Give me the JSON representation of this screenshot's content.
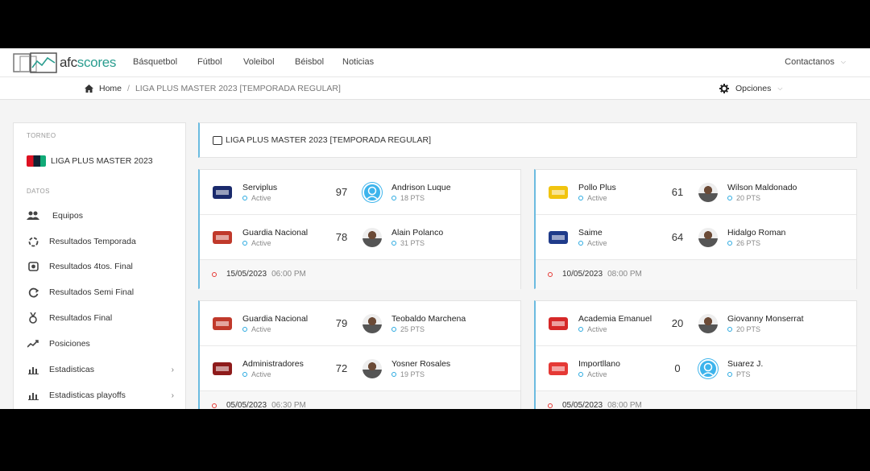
{
  "brand": {
    "name_a": "afc",
    "name_b": "scores"
  },
  "nav": [
    "Básquetbol",
    "Fútbol",
    "Voleibol",
    "Béisbol",
    "Noticias"
  ],
  "contact": "Contactanos",
  "breadcrumb": {
    "home": "Home",
    "current": "LIGA PLUS MASTER 2023 [TEMPORADA REGULAR]"
  },
  "options": "Opciones",
  "sidebar": {
    "torneo_label": "TORNEO",
    "torneo": "LIGA PLUS MASTER 2023",
    "datos_label": "DATOS",
    "items": [
      {
        "label": "Equipos",
        "icon": "users-icon"
      },
      {
        "label": "Resultados Temporada",
        "icon": "refresh-icon"
      },
      {
        "label": "Resultados 4tos. Final",
        "icon": "trophy-icon"
      },
      {
        "label": "Resultados Semi Final",
        "icon": "cycle-icon"
      },
      {
        "label": "Resultados Final",
        "icon": "medal-icon"
      },
      {
        "label": "Posiciones",
        "icon": "trend-icon"
      },
      {
        "label": "Estadisticas",
        "icon": "bar-chart-icon"
      },
      {
        "label": "Estadisticas playoffs",
        "icon": "bar-chart-icon"
      }
    ]
  },
  "header_title": "LIGA PLUS MASTER 2023 [TEMPORADA REGULAR]",
  "games": [
    {
      "rows": [
        {
          "team": "Serviplus",
          "status": "Active",
          "score": "97",
          "player": "Andrison Luque",
          "pts": "18 PTS",
          "avatar": "default",
          "logo": "#1a2a6c"
        },
        {
          "team": "Guardia Nacional",
          "status": "Active",
          "score": "78",
          "player": "Alain Polanco",
          "pts": "31 PTS",
          "avatar": "photo",
          "logo": "#c0392b"
        }
      ],
      "date": "15/05/2023",
      "time": "06:00 PM"
    },
    {
      "rows": [
        {
          "team": "Pollo Plus",
          "status": "Active",
          "score": "61",
          "player": "Wilson Maldonado",
          "pts": "20 PTS",
          "avatar": "photo",
          "logo": "#f1c40f"
        },
        {
          "team": "Saime",
          "status": "Active",
          "score": "64",
          "player": "Hidalgo Roman",
          "pts": "26 PTS",
          "avatar": "photo",
          "logo": "#1f3b8a"
        }
      ],
      "date": "10/05/2023",
      "time": "08:00 PM"
    },
    {
      "rows": [
        {
          "team": "Guardia Nacional",
          "status": "Active",
          "score": "79",
          "player": "Teobaldo Marchena",
          "pts": "25 PTS",
          "avatar": "photo",
          "logo": "#c0392b"
        },
        {
          "team": "Administradores",
          "status": "Active",
          "score": "72",
          "player": "Yosner Rosales",
          "pts": "19 PTS",
          "avatar": "photo",
          "logo": "#8e1b1b"
        }
      ],
      "date": "05/05/2023",
      "time": "06:30 PM"
    },
    {
      "rows": [
        {
          "team": "Academia Emanuel",
          "status": "Active",
          "score": "20",
          "player": "Giovanny Monserrat",
          "pts": "20 PTS",
          "avatar": "photo",
          "logo": "#d62828"
        },
        {
          "team": "Importllano",
          "status": "Active",
          "score": "0",
          "player": "Suarez J.",
          "pts": "PTS",
          "avatar": "default",
          "logo": "#e53935"
        }
      ],
      "date": "05/05/2023",
      "time": "08:00 PM"
    }
  ]
}
